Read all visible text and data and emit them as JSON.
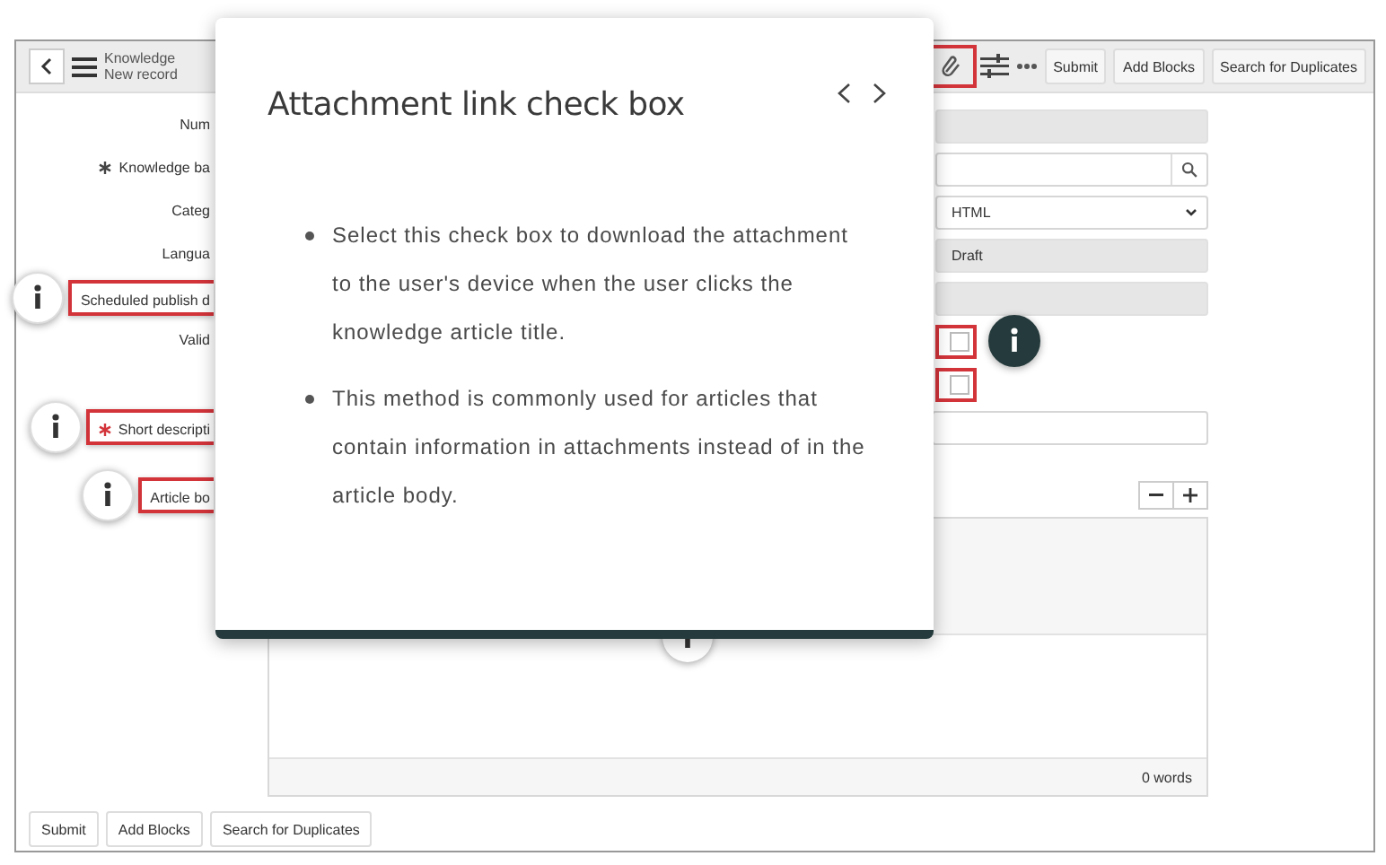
{
  "header": {
    "title": "Knowledge",
    "subtitle": "New record",
    "attachment_highlighted": true,
    "buttons": [
      "Submit",
      "Add Blocks",
      "Search for Duplicates"
    ]
  },
  "form": {
    "rows": [
      {
        "label": "Num",
        "kind": "readonly",
        "required": false,
        "highlighted": false,
        "callout": false
      },
      {
        "label": "Knowledge ba",
        "kind": "lookup",
        "required": true,
        "highlighted": false,
        "callout": false
      },
      {
        "label": "Categ",
        "kind": "select",
        "value": "HTML",
        "required": false,
        "highlighted": false,
        "callout": false
      },
      {
        "label": "Langua",
        "kind": "readonly",
        "value": "Draft",
        "required": false,
        "highlighted": false,
        "callout": false
      },
      {
        "label": "Scheduled publish d",
        "kind": "readonly",
        "required": false,
        "highlighted": true,
        "callout": true
      },
      {
        "label": "Valid",
        "kind": "checkbox",
        "checked": false,
        "field_highlighted": true,
        "field_callout": true,
        "required": false,
        "highlighted": false,
        "callout": false
      },
      {
        "kind": "checkbox",
        "checked": false,
        "field_highlighted": true,
        "field_callout": false
      },
      {
        "label": "Short descripti",
        "kind": "text",
        "required": true,
        "highlighted": true,
        "callout": true
      }
    ],
    "article_body": {
      "label": "Article bo",
      "highlighted": true,
      "callout": true,
      "word_count": "0 words"
    },
    "buttons": [
      "Submit",
      "Add Blocks",
      "Search for Duplicates"
    ]
  },
  "popup": {
    "title": "Attachment link check box",
    "bullets": [
      "Select this check box to download the attachment to the user's device when the user clicks the knowledge article title.",
      "This method is commonly used for articles that contain information in attachments instead of in the article body."
    ]
  }
}
